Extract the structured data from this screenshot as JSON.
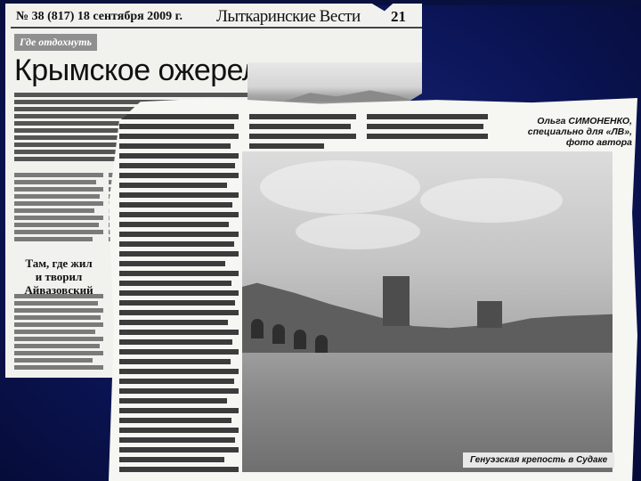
{
  "back_page": {
    "issue": "№ 38 (817) 18 сентября 2009 г.",
    "masthead": "Лыткаринские Вести",
    "page_number": "21",
    "section": "Где отдохнуть",
    "headline": "Крымское ожерелье",
    "subhead": "Там, где жил и творил Айвазовский"
  },
  "front_page": {
    "byline": "Ольга СИМОНЕНКО, специально для «ЛВ», фото автора",
    "photo_caption": "Генуэзская крепость в Судаке"
  }
}
